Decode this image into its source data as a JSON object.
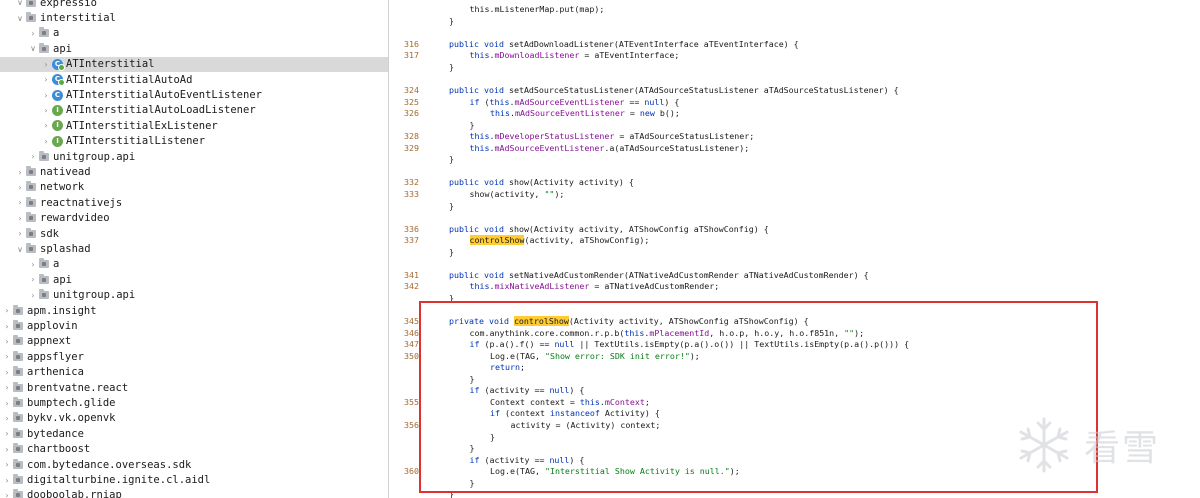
{
  "tree": {
    "items": [
      {
        "label": "expressio",
        "indent": 1,
        "kind": "folder",
        "chevron": "open"
      },
      {
        "label": "interstitial",
        "indent": 1,
        "kind": "folder",
        "chevron": "open"
      },
      {
        "label": "a",
        "indent": 2,
        "kind": "folder",
        "chevron": "closed"
      },
      {
        "label": "api",
        "indent": 2,
        "kind": "folder",
        "chevron": "open"
      },
      {
        "label": "ATInterstitial",
        "indent": 3,
        "kind": "class-g",
        "chevron": "closed",
        "selected": true
      },
      {
        "label": "ATInterstitialAutoAd",
        "indent": 3,
        "kind": "class-g",
        "chevron": "closed"
      },
      {
        "label": "ATInterstitialAutoEventListener",
        "indent": 3,
        "kind": "class",
        "chevron": "closed"
      },
      {
        "label": "ATInterstitialAutoLoadListener",
        "indent": 3,
        "kind": "interface",
        "chevron": "closed"
      },
      {
        "label": "ATInterstitialExListener",
        "indent": 3,
        "kind": "interface",
        "chevron": "closed"
      },
      {
        "label": "ATInterstitialListener",
        "indent": 3,
        "kind": "interface",
        "chevron": "closed"
      },
      {
        "label": "unitgroup.api",
        "indent": 2,
        "kind": "folder",
        "chevron": "closed"
      },
      {
        "label": "nativead",
        "indent": 1,
        "kind": "folder",
        "chevron": "closed"
      },
      {
        "label": "network",
        "indent": 1,
        "kind": "folder",
        "chevron": "closed"
      },
      {
        "label": "reactnativejs",
        "indent": 1,
        "kind": "folder",
        "chevron": "closed"
      },
      {
        "label": "rewardvideo",
        "indent": 1,
        "kind": "folder",
        "chevron": "closed"
      },
      {
        "label": "sdk",
        "indent": 1,
        "kind": "folder",
        "chevron": "closed"
      },
      {
        "label": "splashad",
        "indent": 1,
        "kind": "folder",
        "chevron": "open"
      },
      {
        "label": "a",
        "indent": 2,
        "kind": "folder",
        "chevron": "closed"
      },
      {
        "label": "api",
        "indent": 2,
        "kind": "folder",
        "chevron": "closed"
      },
      {
        "label": "unitgroup.api",
        "indent": 2,
        "kind": "folder",
        "chevron": "closed"
      },
      {
        "label": "apm.insight",
        "indent": 0,
        "kind": "folder",
        "chevron": "closed"
      },
      {
        "label": "applovin",
        "indent": 0,
        "kind": "folder",
        "chevron": "closed"
      },
      {
        "label": "appnext",
        "indent": 0,
        "kind": "folder",
        "chevron": "closed"
      },
      {
        "label": "appsflyer",
        "indent": 0,
        "kind": "folder",
        "chevron": "closed"
      },
      {
        "label": "arthenica",
        "indent": 0,
        "kind": "folder",
        "chevron": "closed"
      },
      {
        "label": "brentvatne.react",
        "indent": 0,
        "kind": "folder",
        "chevron": "closed"
      },
      {
        "label": "bumptech.glide",
        "indent": 0,
        "kind": "folder",
        "chevron": "closed"
      },
      {
        "label": "bykv.vk.openvk",
        "indent": 0,
        "kind": "folder",
        "chevron": "closed"
      },
      {
        "label": "bytedance",
        "indent": 0,
        "kind": "folder",
        "chevron": "closed"
      },
      {
        "label": "chartboost",
        "indent": 0,
        "kind": "folder",
        "chevron": "closed"
      },
      {
        "label": "com.bytedance.overseas.sdk",
        "indent": 0,
        "kind": "folder",
        "chevron": "closed"
      },
      {
        "label": "digitalturbine.ignite.cl.aidl",
        "indent": 0,
        "kind": "folder",
        "chevron": "closed"
      },
      {
        "label": "dooboolab.rniap",
        "indent": 0,
        "kind": "folder",
        "chevron": "closed"
      }
    ]
  },
  "editor": {
    "lines": [
      {
        "ln": "",
        "row": 0,
        "indent": 2,
        "tokens": [
          [
            "plain",
            "this.mListenerMap.put(map);"
          ]
        ]
      },
      {
        "ln": "",
        "row": 1,
        "indent": 1,
        "tokens": [
          [
            "plain",
            "}"
          ]
        ]
      },
      {
        "ln": "316",
        "row": 3,
        "indent": 1,
        "tokens": [
          [
            "kw",
            "public void "
          ],
          [
            "plain",
            "setAdDownloadListener(ATEventInterface aTEventInterface) {"
          ]
        ]
      },
      {
        "ln": "317",
        "row": 4,
        "indent": 2,
        "tokens": [
          [
            "kw",
            "this"
          ],
          [
            "plain",
            "."
          ],
          [
            "field",
            "mDownloadListener"
          ],
          [
            "plain",
            " = aTEventInterface;"
          ]
        ]
      },
      {
        "ln": "",
        "row": 5,
        "indent": 1,
        "tokens": [
          [
            "plain",
            "}"
          ]
        ]
      },
      {
        "ln": "324",
        "row": 7,
        "indent": 1,
        "tokens": [
          [
            "kw",
            "public void "
          ],
          [
            "plain",
            "setAdSourceStatusListener(ATAdSourceStatusListener aTAdSourceStatusListener) {"
          ]
        ]
      },
      {
        "ln": "325",
        "row": 8,
        "indent": 2,
        "tokens": [
          [
            "kw",
            "if "
          ],
          [
            "plain",
            "("
          ],
          [
            "kw",
            "this"
          ],
          [
            "plain",
            "."
          ],
          [
            "field",
            "mAdSourceEventListener"
          ],
          [
            "plain",
            " == "
          ],
          [
            "kw",
            "null"
          ],
          [
            "plain",
            ") {"
          ]
        ]
      },
      {
        "ln": "326",
        "row": 9,
        "indent": 3,
        "tokens": [
          [
            "kw",
            "this"
          ],
          [
            "plain",
            "."
          ],
          [
            "field",
            "mAdSourceEventListener"
          ],
          [
            "plain",
            " = "
          ],
          [
            "kw",
            "new "
          ],
          [
            "plain",
            "b();"
          ]
        ]
      },
      {
        "ln": "",
        "row": 10,
        "indent": 2,
        "tokens": [
          [
            "plain",
            "}"
          ]
        ]
      },
      {
        "ln": "328",
        "row": 11,
        "indent": 2,
        "tokens": [
          [
            "kw",
            "this"
          ],
          [
            "plain",
            "."
          ],
          [
            "field",
            "mDeveloperStatusListener"
          ],
          [
            "plain",
            " = aTAdSourceStatusListener;"
          ]
        ]
      },
      {
        "ln": "329",
        "row": 12,
        "indent": 2,
        "tokens": [
          [
            "kw",
            "this"
          ],
          [
            "plain",
            "."
          ],
          [
            "field",
            "mAdSourceEventListener"
          ],
          [
            "plain",
            ".a(aTAdSourceStatusListener);"
          ]
        ]
      },
      {
        "ln": "",
        "row": 13,
        "indent": 1,
        "tokens": [
          [
            "plain",
            "}"
          ]
        ]
      },
      {
        "ln": "332",
        "row": 15,
        "indent": 1,
        "tokens": [
          [
            "kw",
            "public void "
          ],
          [
            "plain",
            "show(Activity activity) {"
          ]
        ]
      },
      {
        "ln": "333",
        "row": 16,
        "indent": 2,
        "tokens": [
          [
            "plain",
            "show(activity, "
          ],
          [
            "str",
            "\"\""
          ],
          [
            "plain",
            ");"
          ]
        ]
      },
      {
        "ln": "",
        "row": 17,
        "indent": 1,
        "tokens": [
          [
            "plain",
            "}"
          ]
        ]
      },
      {
        "ln": "336",
        "row": 19,
        "indent": 1,
        "tokens": [
          [
            "kw",
            "public void "
          ],
          [
            "plain",
            "show(Activity activity, ATShowConfig aTShowConfig) {"
          ]
        ]
      },
      {
        "ln": "337",
        "row": 20,
        "indent": 2,
        "tokens": [
          [
            "hl",
            "controlShow"
          ],
          [
            "plain",
            "(activity, aTShowConfig);"
          ]
        ]
      },
      {
        "ln": "",
        "row": 21,
        "indent": 1,
        "tokens": [
          [
            "plain",
            "}"
          ]
        ]
      },
      {
        "ln": "341",
        "row": 23,
        "indent": 1,
        "tokens": [
          [
            "kw",
            "public void "
          ],
          [
            "plain",
            "setNativeAdCustomRender(ATNativeAdCustomRender aTNativeAdCustomRender) {"
          ]
        ]
      },
      {
        "ln": "342",
        "row": 24,
        "indent": 2,
        "tokens": [
          [
            "kw",
            "this"
          ],
          [
            "plain",
            "."
          ],
          [
            "field",
            "mixNativeAdListener"
          ],
          [
            "plain",
            " = aTNativeAdCustomRender;"
          ]
        ]
      },
      {
        "ln": "",
        "row": 25,
        "indent": 1,
        "tokens": [
          [
            "plain",
            "}"
          ]
        ]
      },
      {
        "ln": "345",
        "row": 27,
        "indent": 1,
        "tokens": [
          [
            "kw",
            "private void "
          ],
          [
            "hl",
            "controlShow"
          ],
          [
            "plain",
            "(Activity activity, ATShowConfig aTShowConfig) {"
          ]
        ]
      },
      {
        "ln": "346",
        "row": 28,
        "indent": 2,
        "tokens": [
          [
            "plain",
            "com.anythink.core.common.r.p.b("
          ],
          [
            "kw",
            "this"
          ],
          [
            "plain",
            "."
          ],
          [
            "field",
            "mPlacementId"
          ],
          [
            "plain",
            ", h.o.p, h.o.y, h.o.f851n, "
          ],
          [
            "str",
            "\"\""
          ],
          [
            "plain",
            ");"
          ]
        ]
      },
      {
        "ln": "347",
        "row": 29,
        "indent": 2,
        "tokens": [
          [
            "kw",
            "if "
          ],
          [
            "plain",
            "(p.a().f() == "
          ],
          [
            "kw",
            "null"
          ],
          [
            "plain",
            " || TextUtils.isEmpty(p.a().o()) || TextUtils.isEmpty(p.a().p())) {"
          ]
        ]
      },
      {
        "ln": "350",
        "row": 30,
        "indent": 3,
        "tokens": [
          [
            "plain",
            "Log.e(TAG, "
          ],
          [
            "str",
            "\"Show error: SDK init error!\""
          ],
          [
            "plain",
            ");"
          ]
        ]
      },
      {
        "ln": "",
        "row": 31,
        "indent": 3,
        "tokens": [
          [
            "kw",
            "return"
          ],
          [
            "plain",
            ";"
          ]
        ]
      },
      {
        "ln": "",
        "row": 32,
        "indent": 2,
        "tokens": [
          [
            "plain",
            "}"
          ]
        ]
      },
      {
        "ln": "",
        "row": 33,
        "indent": 2,
        "tokens": [
          [
            "kw",
            "if "
          ],
          [
            "plain",
            "(activity == "
          ],
          [
            "kw",
            "null"
          ],
          [
            "plain",
            ") {"
          ]
        ]
      },
      {
        "ln": "355",
        "row": 34,
        "indent": 3,
        "tokens": [
          [
            "plain",
            "Context context = "
          ],
          [
            "kw",
            "this"
          ],
          [
            "plain",
            "."
          ],
          [
            "field",
            "mContext"
          ],
          [
            "plain",
            ";"
          ]
        ]
      },
      {
        "ln": "",
        "row": 35,
        "indent": 3,
        "tokens": [
          [
            "kw",
            "if "
          ],
          [
            "plain",
            "(context "
          ],
          [
            "kw",
            "instanceof "
          ],
          [
            "plain",
            "Activity) {"
          ]
        ]
      },
      {
        "ln": "356",
        "row": 36,
        "indent": 4,
        "tokens": [
          [
            "plain",
            "activity = (Activity) context;"
          ]
        ]
      },
      {
        "ln": "",
        "row": 37,
        "indent": 3,
        "tokens": [
          [
            "plain",
            "}"
          ]
        ]
      },
      {
        "ln": "",
        "row": 38,
        "indent": 2,
        "tokens": [
          [
            "plain",
            "}"
          ]
        ]
      },
      {
        "ln": "",
        "row": 39,
        "indent": 2,
        "tokens": [
          [
            "kw",
            "if "
          ],
          [
            "plain",
            "(activity == "
          ],
          [
            "kw",
            "null"
          ],
          [
            "plain",
            ") {"
          ]
        ]
      },
      {
        "ln": "360",
        "row": 40,
        "indent": 3,
        "tokens": [
          [
            "plain",
            "Log.e(TAG, "
          ],
          [
            "str",
            "\"Interstitial Show Activity is null.\""
          ],
          [
            "plain",
            ");"
          ]
        ]
      },
      {
        "ln": "",
        "row": 41,
        "indent": 2,
        "tokens": [
          [
            "plain",
            "}"
          ]
        ]
      },
      {
        "ln": "",
        "row": 42,
        "indent": 1,
        "tokens": [
          [
            "plain",
            "}"
          ]
        ]
      }
    ]
  },
  "watermark": {
    "text": "看雪"
  },
  "colors": {
    "keyword": "#0033b3",
    "string": "#067d17",
    "field": "#871094",
    "highlight": "#ffcc33",
    "annotation_box": "#e03131",
    "selection": "#d9d9d9",
    "line_number": "#a36a2e"
  }
}
